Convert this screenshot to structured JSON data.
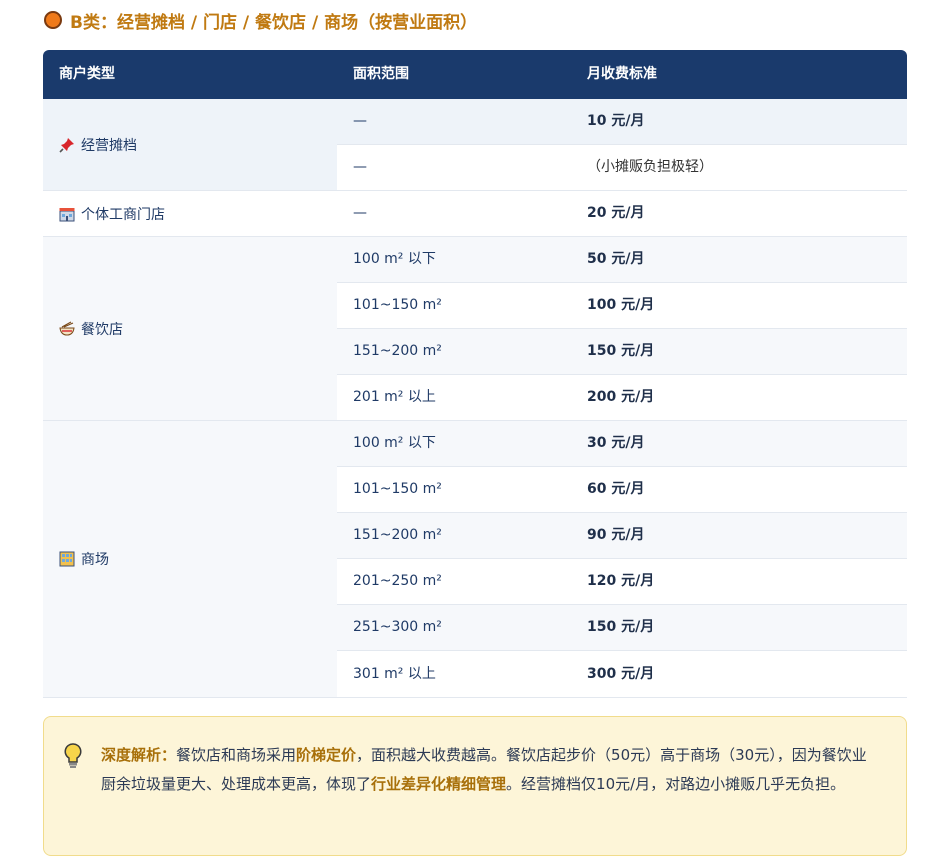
{
  "section": {
    "title": "B类：经营摊档 / 门店 / 餐饮店 / 商场（按营业面积）"
  },
  "table": {
    "headers": [
      "商户类型",
      "面积范围",
      "月收费标准"
    ],
    "groups": [
      {
        "type": "经营摊档",
        "icon": "pushpin-icon",
        "rows": [
          {
            "area": "—",
            "fee": "10 元/月"
          },
          {
            "area": "—",
            "note": "（小摊贩负担极轻）"
          }
        ]
      },
      {
        "type": "个体工商门店",
        "icon": "store-icon",
        "rows": [
          {
            "area": "—",
            "fee": "20 元/月"
          }
        ]
      },
      {
        "type": "餐饮店",
        "icon": "noodle-bowl-icon",
        "rows": [
          {
            "area": "100 m² 以下",
            "fee": "50 元/月"
          },
          {
            "area": "101~150 m²",
            "fee": "100 元/月"
          },
          {
            "area": "151~200 m²",
            "fee": "150 元/月"
          },
          {
            "area": "201 m² 以上",
            "fee": "200 元/月"
          }
        ]
      },
      {
        "type": "商场",
        "icon": "mall-building-icon",
        "rows": [
          {
            "area": "100 m² 以下",
            "fee": "30 元/月"
          },
          {
            "area": "101~150 m²",
            "fee": "60 元/月"
          },
          {
            "area": "151~200 m²",
            "fee": "90 元/月"
          },
          {
            "area": "201~250 m²",
            "fee": "120 元/月"
          },
          {
            "area": "251~300 m²",
            "fee": "150 元/月"
          },
          {
            "area": "301 m² 以上",
            "fee": "300 元/月"
          }
        ]
      }
    ]
  },
  "tip": {
    "label": "深度解析：",
    "t1": "餐饮店和商场采用",
    "b1": "阶梯定价",
    "t2": "，面积越大收费越高。餐饮店起步价（50元）高于商场（30元），因为餐饮业厨余垃圾量更大、处理成本更高，体现了",
    "b2": "行业差异化精细管理",
    "t3": "。经营摊档仅10元/月，对路边小摊贩几乎无负担。"
  },
  "colors": {
    "header_bg": "#1a3a6c",
    "accent": "#c07a12",
    "stripe": "#eef3f9",
    "tip_bg": "#fdf5d8"
  }
}
